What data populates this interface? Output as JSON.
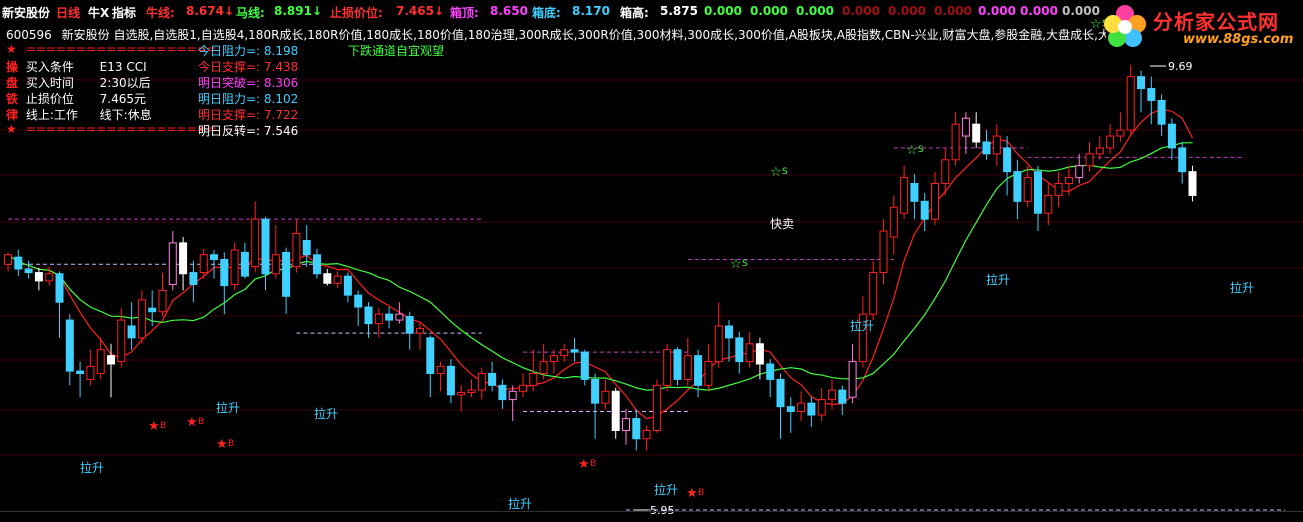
{
  "topbar": {
    "stock": "新安股份",
    "period": "日线",
    "indicator": "牛X",
    "indicator_menu": "指标",
    "niu_label": "牛线:",
    "niu_value": "8.674↓",
    "ma_label": "马线:",
    "ma_value": "8.891↓",
    "stop_label": "止损价位:",
    "stop_value": "7.465↓",
    "box_top_label": "箱顶:",
    "box_top_value": "8.650",
    "box_bottom_label": "箱底:",
    "box_bottom_value": "8.170",
    "box_high_label": "箱高:",
    "box_high_value": "5.875",
    "zeros": [
      "0.000",
      "0.000",
      "0.000",
      "0.000",
      "0.000",
      "0.000",
      "0.000",
      "0.000",
      "0.000"
    ]
  },
  "infoline": {
    "code": "600596",
    "tags": "新安股份 自选股,自选股1,自选股4,180R成长,180R价值,180成长,180价值,180治理,300R成长,300R价值,300材料,300成长,300价值,A股板块,A股指数,CBN-兴业,财富大盘,参股金融,大盘成长,大盘价值"
  },
  "rules": {
    "separator": "===================",
    "rows": [
      {
        "ch": "操",
        "label": "买入条件",
        "value": "E13 CCI"
      },
      {
        "ch": "盘",
        "label": "买入时间",
        "value": "2:30以后"
      },
      {
        "ch": "铁",
        "label": "止损价位",
        "value": "7.465元"
      },
      {
        "ch": "律",
        "label": "线上:工作",
        "value": "线下:休息"
      }
    ]
  },
  "levels": [
    {
      "text": "今日阻力=: 8.198",
      "color": "#40d0ff"
    },
    {
      "text": "今日支撑=: 7.438",
      "color": "#ff3030"
    },
    {
      "text": "明日突破=: 8.306",
      "color": "#ff40ff"
    },
    {
      "text": "明日阻力=: 8.102",
      "color": "#40d0ff"
    },
    {
      "text": "明日支撑=: 7.722",
      "color": "#ff3030"
    },
    {
      "text": "明日反转=: 7.546",
      "color": "#ffffff"
    }
  ],
  "hint": "下跌通道自宜观望",
  "logo": {
    "title": "分析家公式网",
    "url": "www.88gs.com"
  },
  "chart_data": {
    "type": "candlestick",
    "price_high_label": "9.69",
    "price_low_label": "5.95",
    "marker_labels": {
      "up": "拉升",
      "buy": "B",
      "sell": "S",
      "fast_sell": "快卖"
    },
    "candles": [
      [
        8.02,
        8.1,
        8.12,
        7.96
      ],
      [
        8.08,
        7.98,
        8.14,
        7.92
      ],
      [
        7.98,
        7.95,
        8.05,
        7.9
      ],
      [
        7.95,
        7.88,
        7.99,
        7.8
      ],
      [
        7.88,
        7.94,
        8.0,
        7.84
      ],
      [
        7.94,
        7.7,
        7.96,
        7.4
      ],
      [
        7.55,
        7.12,
        7.6,
        7.0
      ],
      [
        7.12,
        7.1,
        7.2,
        6.9
      ],
      [
        7.05,
        7.16,
        7.3,
        7.0
      ],
      [
        7.1,
        7.3,
        7.4,
        7.05
      ],
      [
        7.25,
        7.18,
        7.35,
        6.9
      ],
      [
        7.2,
        7.55,
        7.65,
        7.15
      ],
      [
        7.5,
        7.4,
        7.7,
        7.3
      ],
      [
        7.4,
        7.72,
        7.8,
        7.35
      ],
      [
        7.65,
        7.62,
        7.8,
        7.5
      ],
      [
        7.62,
        7.8,
        7.95,
        7.58
      ],
      [
        7.85,
        8.2,
        8.3,
        7.8
      ],
      [
        8.2,
        7.94,
        8.25,
        7.8
      ],
      [
        7.95,
        7.85,
        8.05,
        7.7
      ],
      [
        7.95,
        8.1,
        8.15,
        7.9
      ],
      [
        8.1,
        8.06,
        8.14,
        7.9
      ],
      [
        8.06,
        7.84,
        8.12,
        7.6
      ],
      [
        7.85,
        8.14,
        8.2,
        7.8
      ],
      [
        8.12,
        7.92,
        8.2,
        7.9
      ],
      [
        8.0,
        8.4,
        8.55,
        7.95
      ],
      [
        8.4,
        7.94,
        8.42,
        7.8
      ],
      [
        7.94,
        8.1,
        8.35,
        7.9
      ],
      [
        8.12,
        7.75,
        8.16,
        7.6
      ],
      [
        8.0,
        8.28,
        8.4,
        7.95
      ],
      [
        8.22,
        8.1,
        8.35,
        8.0
      ],
      [
        8.1,
        7.94,
        8.15,
        7.9
      ],
      [
        7.94,
        7.86,
        7.98,
        7.84
      ],
      [
        7.86,
        7.92,
        7.96,
        7.82
      ],
      [
        7.92,
        7.76,
        7.95,
        7.7
      ],
      [
        7.76,
        7.66,
        7.8,
        7.5
      ],
      [
        7.66,
        7.52,
        7.7,
        7.4
      ],
      [
        7.52,
        7.6,
        7.65,
        7.4
      ],
      [
        7.6,
        7.55,
        7.66,
        7.48
      ],
      [
        7.55,
        7.6,
        7.7,
        7.52
      ],
      [
        7.58,
        7.44,
        7.62,
        7.3
      ],
      [
        7.44,
        7.48,
        7.54,
        7.3
      ],
      [
        7.4,
        7.1,
        7.42,
        6.9
      ],
      [
        7.1,
        7.16,
        7.2,
        6.95
      ],
      [
        7.16,
        6.92,
        7.22,
        6.85
      ],
      [
        6.92,
        6.94,
        7.0,
        6.78
      ],
      [
        6.94,
        6.96,
        7.05,
        6.9
      ],
      [
        6.96,
        7.1,
        7.15,
        6.88
      ],
      [
        7.1,
        7.0,
        7.2,
        6.95
      ],
      [
        7.0,
        6.88,
        7.05,
        6.8
      ],
      [
        6.88,
        6.95,
        7.0,
        6.7
      ],
      [
        6.95,
        7.0,
        7.1,
        6.9
      ],
      [
        7.0,
        7.1,
        7.3,
        6.95
      ],
      [
        7.1,
        7.2,
        7.35,
        7.05
      ],
      [
        7.2,
        7.25,
        7.3,
        7.1
      ],
      [
        7.25,
        7.3,
        7.35,
        7.2
      ],
      [
        7.3,
        7.28,
        7.4,
        7.2
      ],
      [
        7.28,
        7.05,
        7.3,
        7.0
      ],
      [
        7.05,
        6.85,
        7.1,
        6.55
      ],
      [
        6.85,
        6.95,
        7.05,
        6.8
      ],
      [
        6.95,
        6.62,
        6.98,
        6.55
      ],
      [
        6.62,
        6.72,
        6.8,
        6.5
      ],
      [
        6.72,
        6.55,
        6.8,
        6.45
      ],
      [
        6.55,
        6.62,
        6.66,
        6.45
      ],
      [
        6.62,
        7.0,
        7.05,
        6.6
      ],
      [
        7.0,
        7.3,
        7.35,
        6.95
      ],
      [
        7.3,
        7.05,
        7.32,
        7.0
      ],
      [
        7.05,
        7.25,
        7.4,
        7.0
      ],
      [
        7.25,
        7.0,
        7.3,
        6.9
      ],
      [
        7.0,
        7.2,
        7.35,
        6.95
      ],
      [
        7.2,
        7.5,
        7.7,
        7.15
      ],
      [
        7.5,
        7.4,
        7.55,
        7.2
      ],
      [
        7.4,
        7.2,
        7.45,
        7.1
      ],
      [
        7.2,
        7.35,
        7.45,
        7.15
      ],
      [
        7.35,
        7.18,
        7.4,
        7.05
      ],
      [
        7.18,
        7.05,
        7.22,
        6.9
      ],
      [
        7.05,
        6.82,
        7.1,
        6.55
      ],
      [
        6.82,
        6.78,
        6.9,
        6.6
      ],
      [
        6.78,
        6.85,
        6.95,
        6.7
      ],
      [
        6.85,
        6.75,
        6.9,
        6.65
      ],
      [
        6.75,
        6.88,
        6.98,
        6.7
      ],
      [
        6.88,
        6.96,
        7.05,
        6.8
      ],
      [
        6.96,
        6.85,
        7.0,
        6.75
      ],
      [
        6.9,
        7.2,
        7.35,
        6.85
      ],
      [
        7.2,
        7.6,
        7.75,
        7.15
      ],
      [
        7.6,
        7.95,
        8.05,
        7.55
      ],
      [
        7.95,
        8.3,
        8.4,
        7.85
      ],
      [
        8.25,
        8.5,
        8.6,
        8.1
      ],
      [
        8.45,
        8.75,
        8.85,
        8.4
      ],
      [
        8.7,
        8.55,
        8.78,
        8.4
      ],
      [
        8.55,
        8.4,
        8.62,
        8.3
      ],
      [
        8.4,
        8.7,
        8.8,
        8.35
      ],
      [
        8.7,
        8.9,
        9.0,
        8.6
      ],
      [
        8.9,
        9.2,
        9.3,
        8.85
      ],
      [
        9.1,
        9.25,
        9.3,
        8.95
      ],
      [
        9.2,
        9.05,
        9.3,
        9.0
      ],
      [
        9.05,
        8.95,
        9.15,
        8.9
      ],
      [
        8.95,
        9.1,
        9.2,
        8.85
      ],
      [
        9.0,
        8.8,
        9.1,
        8.6
      ],
      [
        8.8,
        8.55,
        8.9,
        8.4
      ],
      [
        8.55,
        8.75,
        8.85,
        8.5
      ],
      [
        8.8,
        8.45,
        8.85,
        8.3
      ],
      [
        8.45,
        8.6,
        8.7,
        8.35
      ],
      [
        8.6,
        8.7,
        8.8,
        8.5
      ],
      [
        8.7,
        8.75,
        8.85,
        8.6
      ],
      [
        8.75,
        8.85,
        8.95,
        8.7
      ],
      [
        8.85,
        8.95,
        9.05,
        8.8
      ],
      [
        8.95,
        9.0,
        9.1,
        8.9
      ],
      [
        9.0,
        9.1,
        9.2,
        8.95
      ],
      [
        9.1,
        9.15,
        9.3,
        9.05
      ],
      [
        9.15,
        9.6,
        9.7,
        9.1
      ],
      [
        9.6,
        9.5,
        9.65,
        9.3
      ],
      [
        9.5,
        9.4,
        9.6,
        9.2
      ],
      [
        9.4,
        9.2,
        9.45,
        9.1
      ],
      [
        9.2,
        9.0,
        9.25,
        8.9
      ],
      [
        9.0,
        8.8,
        9.05,
        8.7
      ],
      [
        8.8,
        8.6,
        8.85,
        8.55
      ]
    ]
  }
}
